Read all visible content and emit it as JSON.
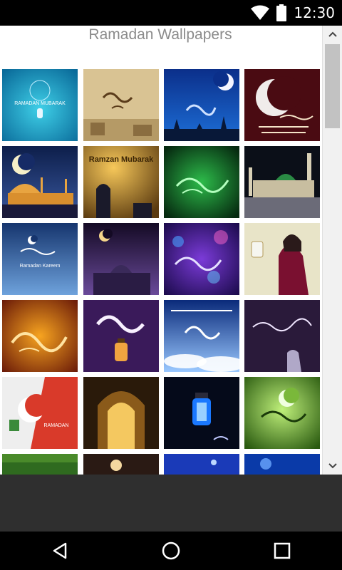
{
  "status_bar": {
    "time": "12:30",
    "icons": [
      "wifi-icon",
      "battery-icon"
    ]
  },
  "app": {
    "title": "Ramadan Wallpapers"
  },
  "tiles": [
    {
      "name": "wallpaper-ramadan-mubarak-lantern",
      "caption": "RAMADAN MUBARAK"
    },
    {
      "name": "wallpaper-calligraphy-parchment",
      "caption": ""
    },
    {
      "name": "wallpaper-crescent-blue-night",
      "caption": ""
    },
    {
      "name": "wallpaper-crescent-dark-red",
      "caption": ""
    },
    {
      "name": "wallpaper-mosque-moon-night",
      "caption": ""
    },
    {
      "name": "wallpaper-ramzan-mubarak-prayer",
      "caption": "Ramzan Mubarak"
    },
    {
      "name": "wallpaper-green-calligraphy",
      "caption": ""
    },
    {
      "name": "wallpaper-mosque-night-green-dome",
      "caption": ""
    },
    {
      "name": "wallpaper-ramadan-kareem-blue",
      "caption": "Ramadan Kareem"
    },
    {
      "name": "wallpaper-ramadan-mubarak-purple",
      "caption": ""
    },
    {
      "name": "wallpaper-bokeh-calligraphy",
      "caption": ""
    },
    {
      "name": "wallpaper-girl-with-lantern",
      "caption": ""
    },
    {
      "name": "wallpaper-orange-calligraphy",
      "caption": ""
    },
    {
      "name": "wallpaper-ramadan-kareem-lantern-purple",
      "caption": ""
    },
    {
      "name": "wallpaper-muhammad-clouds",
      "caption": ""
    },
    {
      "name": "wallpaper-praying-man-purple",
      "caption": ""
    },
    {
      "name": "wallpaper-ramadan-red-white",
      "caption": "RAMADAN"
    },
    {
      "name": "wallpaper-arched-doorway",
      "caption": ""
    },
    {
      "name": "wallpaper-blue-lantern",
      "caption": ""
    },
    {
      "name": "wallpaper-green-crescent-calligraphy",
      "caption": ""
    },
    {
      "name": "wallpaper-green-partial",
      "caption": ""
    },
    {
      "name": "wallpaper-lantern-partial",
      "caption": ""
    },
    {
      "name": "wallpaper-blue-stars-partial",
      "caption": ""
    },
    {
      "name": "wallpaper-blue-glow-partial",
      "caption": ""
    }
  ],
  "nav_bar": {
    "back": "back-icon",
    "home": "home-icon",
    "recents": "recents-icon"
  },
  "colors": {
    "statusbar": "#000000",
    "content": "#ffffff",
    "title_text": "#8b8b8b",
    "grey_area": "#2f2f2f"
  }
}
